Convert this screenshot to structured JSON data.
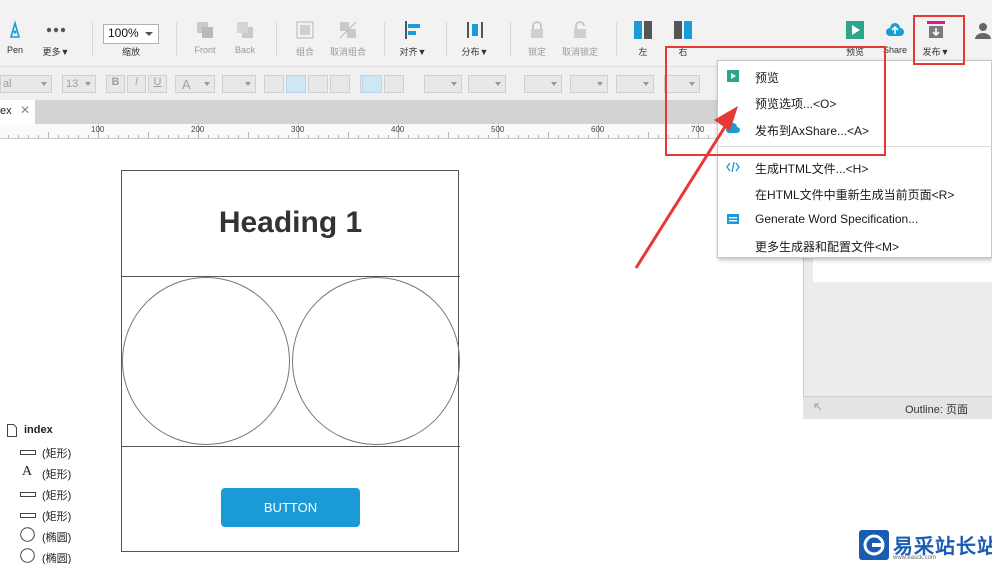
{
  "toolbar": {
    "pen": "Pen",
    "more": "更多▼",
    "zoom_value": "100%",
    "zoom_label": "缩放",
    "front": "Front",
    "back": "Back",
    "group": "组合",
    "ungroup": "取消组合",
    "align": "对齐▼",
    "distribute": "分布▼",
    "lock": "锁定",
    "unlock": "取消锁定",
    "left": "左",
    "right": "右",
    "preview": "预览",
    "share": "Share",
    "publish": "发布▼"
  },
  "format_bar": {
    "font": "al",
    "size": "13",
    "bold": "B",
    "italic": "I",
    "underline": "U",
    "text_a": "A"
  },
  "tab": {
    "name": "ex",
    "close": "✕"
  },
  "ruler": {
    "labels": [
      "100",
      "200",
      "300",
      "400",
      "500",
      "600",
      "700"
    ]
  },
  "canvas": {
    "heading": "Heading 1",
    "button_label": "BUTTON"
  },
  "publish_menu": {
    "items": [
      {
        "label": "预览"
      },
      {
        "label": "预览选项...<O>"
      },
      {
        "label": "发布到AxShare...<A>"
      },
      {
        "label": "生成HTML文件...<H>"
      },
      {
        "label": "在HTML文件中重新生成当前页面<R>"
      },
      {
        "label": "Generate Word Specification..."
      },
      {
        "label": "更多生成器和配置文件<M>"
      }
    ]
  },
  "outline": {
    "title": "Outline: 页面",
    "root": "index",
    "items": [
      "(矩形)",
      "(矩形)",
      "(矩形)",
      "(矩形)",
      "(椭圆)",
      "(椭圆)"
    ]
  },
  "watermark": {
    "text": "易采站长站",
    "sub": "www.easck.com"
  },
  "colors": {
    "accent": "#1a9bd7",
    "annotation": "#e53935",
    "watermark": "#1a5bb3"
  }
}
